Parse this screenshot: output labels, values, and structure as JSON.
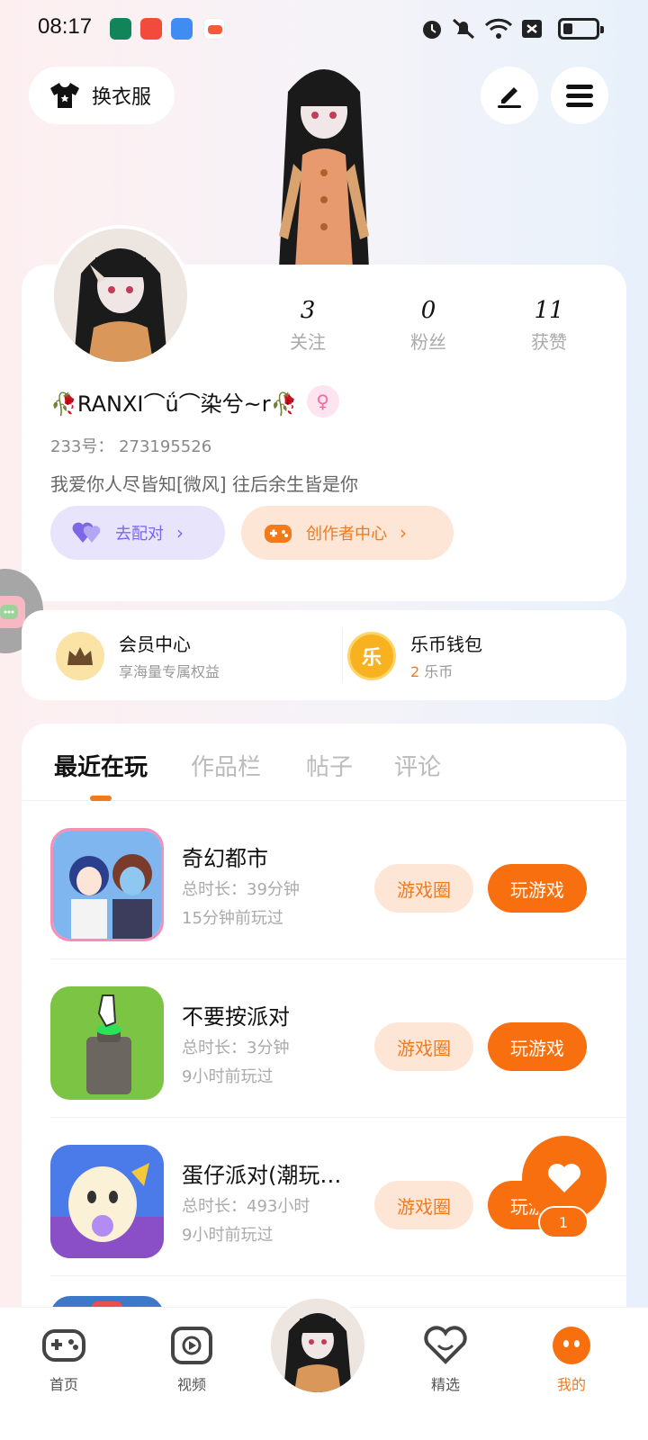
{
  "status_bar": {
    "time": "08:17"
  },
  "top": {
    "outfit_label": "换衣服"
  },
  "profile": {
    "stats": [
      {
        "value": "3",
        "label": "关注"
      },
      {
        "value": "0",
        "label": "粉丝"
      },
      {
        "value": "11",
        "label": "获赞"
      }
    ],
    "nickname": "🥀RANXI⌒ǘ⌒染兮~r🥀",
    "uid": "233号： 273195526",
    "bio": "我爱你人尽皆知[微风] 往后余生皆是你",
    "match_label": "去配对",
    "creator_label": "创作者中心"
  },
  "member": {
    "vip_title": "会员中心",
    "vip_sub": "享海量专属权益",
    "wallet_title": "乐币钱包",
    "wallet_amount": "2",
    "wallet_unit": "乐币",
    "wallet_icon_text": "乐"
  },
  "tabs": [
    "最近在玩",
    "作品栏",
    "帖子",
    "评论"
  ],
  "games": [
    {
      "name": "奇幻都市",
      "duration": "总时长：39分钟",
      "last_played": "15分钟前玩过",
      "circle_label": "游戏圈",
      "play_label": "玩游戏"
    },
    {
      "name": "不要按派对",
      "duration": "总时长：3分钟",
      "last_played": "9小时前玩过",
      "circle_label": "游戏圈",
      "play_label": "玩游戏"
    },
    {
      "name": "蛋仔派对(潮玩…",
      "duration": "总时长：493小时",
      "last_played": "9小时前玩过",
      "circle_label": "游戏圈",
      "play_label": "玩游戏"
    }
  ],
  "floating_like": {
    "count": "1"
  },
  "bottom_nav": {
    "home": "首页",
    "video": "视频",
    "featured": "精选",
    "mine": "我的"
  },
  "colors": {
    "accent": "#f86f10",
    "accent_light": "#fde6d6",
    "match_bg": "#e7e4fb",
    "match_fg": "#7e67e6"
  }
}
